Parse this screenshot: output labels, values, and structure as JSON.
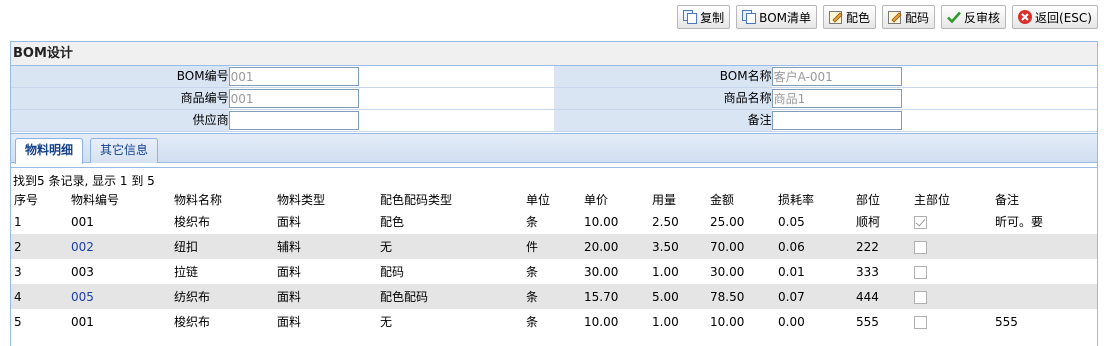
{
  "toolbar": {
    "buttons": [
      {
        "label": "复制",
        "icon": "copy-icon"
      },
      {
        "label": "BOM清单",
        "icon": "copy-icon"
      },
      {
        "label": "配色",
        "icon": "edit-icon"
      },
      {
        "label": "配码",
        "icon": "edit-icon"
      },
      {
        "label": "反审核",
        "icon": "check-icon"
      },
      {
        "label": "返回(ESC)",
        "icon": "close-icon"
      }
    ]
  },
  "panel": {
    "title": "BOM设计",
    "fields": {
      "bom_code_label": "BOM编号",
      "bom_code_value": "001",
      "bom_name_label": "BOM名称",
      "bom_name_value": "客户A-001",
      "product_code_label": "商品编号",
      "product_code_value": "001",
      "product_name_label": "商品名称",
      "product_name_value": "商品1",
      "supplier_label": "供应商",
      "supplier_value": "",
      "remark_label": "备注",
      "remark_value": ""
    }
  },
  "tabs": [
    {
      "label": "物料明细",
      "active": true
    },
    {
      "label": "其它信息",
      "active": false
    }
  ],
  "grid": {
    "info": "找到5 条记录, 显示  1 到  5",
    "columns": [
      "序号",
      "物料编号",
      "物料名称",
      "物料类型",
      "配色配码类型",
      "单位",
      "单价",
      "用量",
      "金额",
      "损耗率",
      "部位",
      "主部位",
      "备注"
    ],
    "rows": [
      {
        "no": "1",
        "code": "001",
        "name": "梭织布",
        "type": "面料",
        "kind": "配色",
        "unit": "条",
        "price": "10.00",
        "qty": "2.50",
        "amount": "25.00",
        "loss": "0.05",
        "part": "顺柯",
        "main": true,
        "remark": "昕可。要",
        "link": false
      },
      {
        "no": "2",
        "code": "002",
        "name": "纽扣",
        "type": "辅料",
        "kind": "无",
        "unit": "件",
        "price": "20.00",
        "qty": "3.50",
        "amount": "70.00",
        "loss": "0.06",
        "part": "222",
        "main": false,
        "remark": "",
        "link": true
      },
      {
        "no": "3",
        "code": "003",
        "name": "拉链",
        "type": "面料",
        "kind": "配码",
        "unit": "条",
        "price": "30.00",
        "qty": "1.00",
        "amount": "30.00",
        "loss": "0.01",
        "part": "333",
        "main": false,
        "remark": "",
        "link": false
      },
      {
        "no": "4",
        "code": "005",
        "name": "纺织布",
        "type": "面料",
        "kind": "配色配码",
        "unit": "条",
        "price": "15.70",
        "qty": "5.00",
        "amount": "78.50",
        "loss": "0.07",
        "part": "444",
        "main": false,
        "remark": "",
        "link": true
      },
      {
        "no": "5",
        "code": "001",
        "name": "梭织布",
        "type": "面料",
        "kind": "无",
        "unit": "条",
        "price": "10.00",
        "qty": "1.00",
        "amount": "10.00",
        "loss": "0.00",
        "part": "555",
        "main": false,
        "remark": "555",
        "link": false
      }
    ]
  },
  "colors": {
    "accent": "#15428b",
    "header_bg": "#dae5f4",
    "border": "#99bbe8",
    "link": "#1a3fa8"
  }
}
